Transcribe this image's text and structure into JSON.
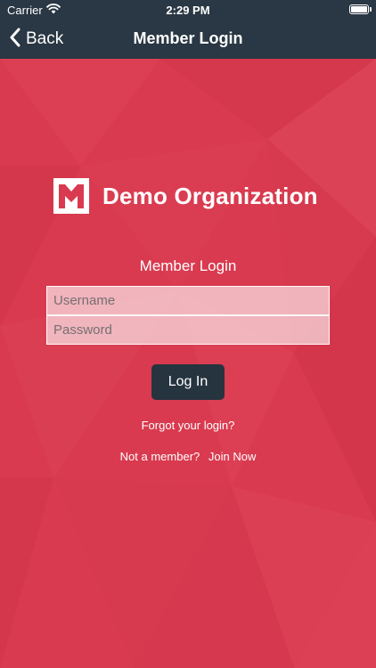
{
  "status_bar": {
    "carrier": "Carrier",
    "time": "2:29 PM"
  },
  "nav": {
    "back_label": "Back",
    "title": "Member Login"
  },
  "brand": {
    "org_name": "Demo Organization",
    "logo_icon": "org-logo-icon"
  },
  "form": {
    "title": "Member Login",
    "username_placeholder": "Username",
    "password_placeholder": "Password",
    "login_label": "Log In",
    "forgot_label": "Forgot your login?",
    "not_member_label": "Not a member?",
    "join_label": "Join Now"
  },
  "colors": {
    "header_bg": "#2a3744",
    "background": "#d93a4f",
    "button_bg": "#263440"
  }
}
